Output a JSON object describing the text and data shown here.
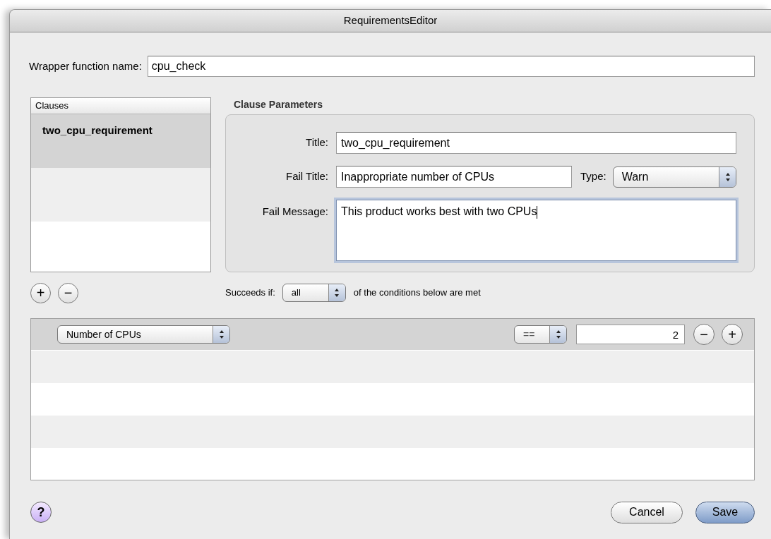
{
  "window": {
    "title": "RequirementsEditor"
  },
  "wrapper": {
    "label": "Wrapper function name:",
    "value": "cpu_check"
  },
  "clauses": {
    "header": "Clauses",
    "items": [
      {
        "label": "two_cpu_requirement",
        "selected": true
      }
    ],
    "add_button": "+",
    "remove_button": "−"
  },
  "clause_parameters": {
    "heading": "Clause Parameters",
    "title": {
      "label": "Title:",
      "value": "two_cpu_requirement"
    },
    "fail_title": {
      "label": "Fail Title:",
      "value": "Inappropriate number of CPUs"
    },
    "type": {
      "label": "Type:",
      "value": "Warn"
    },
    "fail_message": {
      "label": "Fail Message:",
      "value": "This product works best with two CPUs",
      "focused": true
    }
  },
  "succeeds": {
    "label": "Succeeds if:",
    "value": "all",
    "suffix": "of the conditions below are met"
  },
  "conditions": [
    {
      "attribute": "Number of CPUs",
      "operator": "==",
      "value": "2",
      "remove_button": "−",
      "add_button": "+"
    }
  ],
  "help_button": "?",
  "buttons": [
    {
      "label": "Cancel",
      "kind": "normal"
    },
    {
      "label": "Save",
      "kind": "default"
    }
  ]
}
